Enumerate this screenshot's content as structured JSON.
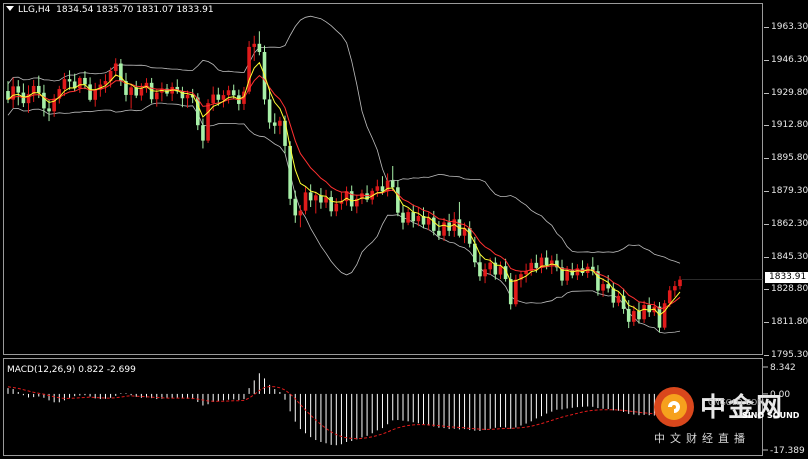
{
  "header": {
    "symbol_tf": "LLG,H4",
    "ohlc": "1834.54 1835.70 1831.07 1833.91"
  },
  "macd": {
    "label": "MACD(12,26,9) 0.822 -2.699",
    "axis_labels": [
      "8.342",
      "0.00",
      "-17.389"
    ]
  },
  "price_axis": [
    "1963.30",
    "1946.30",
    "1929.80",
    "1912.80",
    "1895.80",
    "1879.30",
    "1862.30",
    "1845.30",
    "1828.80",
    "1811.80",
    "1795.30"
  ],
  "current_price": "1833.91",
  "colors": {
    "bull": "#e01b1b",
    "bear": "#a8f0a8",
    "ma": "#ffff33",
    "ma_red": "#ff3030",
    "band": "#bdbdbd",
    "macd_hist": "#ffffff",
    "macd_signal": "#e01b1b"
  },
  "watermark": {
    "brand": "中金网",
    "url": "CNGOLD.COM",
    "sub": "中文财经直播",
    "sound": "SINO SOUND"
  },
  "chart_data": {
    "type": "candlestick",
    "ylim": [
      1795.3,
      1963.3
    ],
    "candles": [
      [
        1930.5,
        1935.6,
        1924.3,
        1926.1
      ],
      [
        1926.1,
        1937.4,
        1921.8,
        1932.9
      ],
      [
        1932.9,
        1936.1,
        1923.2,
        1929.7
      ],
      [
        1929.7,
        1934.4,
        1922.3,
        1924.3
      ],
      [
        1924.3,
        1933.4,
        1919.3,
        1928.9
      ],
      [
        1928.9,
        1936.2,
        1924.9,
        1933.1
      ],
      [
        1933.1,
        1938.4,
        1926.9,
        1929.6
      ],
      [
        1929.6,
        1933.7,
        1917.5,
        1921.6
      ],
      [
        1921.6,
        1926.0,
        1915.1,
        1920.1
      ],
      [
        1920.1,
        1928.9,
        1917.3,
        1926.6
      ],
      [
        1926.6,
        1933.2,
        1924.1,
        1931.5
      ],
      [
        1931.5,
        1939.8,
        1928.0,
        1936.6
      ],
      [
        1936.6,
        1941.1,
        1931.2,
        1935.4
      ],
      [
        1935.4,
        1939.4,
        1930.3,
        1931.9
      ],
      [
        1931.9,
        1938.1,
        1929.5,
        1937.2
      ],
      [
        1937.2,
        1940.7,
        1931.5,
        1933.9
      ],
      [
        1933.9,
        1937.5,
        1925.1,
        1926.0
      ],
      [
        1926.0,
        1934.7,
        1922.5,
        1931.2
      ],
      [
        1931.2,
        1936.6,
        1927.6,
        1933.8
      ],
      [
        1933.8,
        1939.1,
        1929.6,
        1935.6
      ],
      [
        1935.6,
        1942.5,
        1932.3,
        1940.8
      ],
      [
        1940.8,
        1947.3,
        1937.9,
        1944.6
      ],
      [
        1944.6,
        1946.9,
        1933.1,
        1935.6
      ],
      [
        1935.6,
        1939.8,
        1925.2,
        1928.5
      ],
      [
        1928.5,
        1934.2,
        1921.5,
        1932.4
      ],
      [
        1932.4,
        1935.7,
        1926.9,
        1928.2
      ],
      [
        1928.2,
        1934.5,
        1925.6,
        1931.9
      ],
      [
        1931.9,
        1937.1,
        1929.6,
        1934.7
      ],
      [
        1934.7,
        1937.2,
        1924.2,
        1926.3
      ],
      [
        1926.3,
        1931.4,
        1922.5,
        1929.7
      ],
      [
        1929.7,
        1934.9,
        1925.2,
        1931.7
      ],
      [
        1931.7,
        1934.1,
        1927.8,
        1929.2
      ],
      [
        1929.2,
        1934.9,
        1925.4,
        1932.6
      ],
      [
        1932.6,
        1936.5,
        1929.1,
        1930.3
      ],
      [
        1930.3,
        1932.7,
        1922.2,
        1926.8
      ],
      [
        1926.8,
        1930.8,
        1921.9,
        1928.6
      ],
      [
        1928.6,
        1931.6,
        1924.3,
        1927.2
      ],
      [
        1927.2,
        1929.4,
        1910.5,
        1913.0
      ],
      [
        1913.0,
        1916.4,
        1901.1,
        1905.1
      ],
      [
        1905.1,
        1926.3,
        1903.9,
        1924.3
      ],
      [
        1924.3,
        1932.8,
        1920.3,
        1928.7
      ],
      [
        1928.7,
        1932.2,
        1923.0,
        1926.0
      ],
      [
        1926.0,
        1930.9,
        1922.1,
        1928.4
      ],
      [
        1928.4,
        1933.2,
        1924.1,
        1930.9
      ],
      [
        1930.9,
        1933.8,
        1926.5,
        1928.3
      ],
      [
        1928.3,
        1931.2,
        1920.6,
        1923.9
      ],
      [
        1923.9,
        1932.6,
        1920.8,
        1930.2
      ],
      [
        1930.2,
        1956.1,
        1928.9,
        1953.1
      ],
      [
        1953.1,
        1958.8,
        1945.9,
        1954.7
      ],
      [
        1954.7,
        1961.1,
        1948.8,
        1950.5
      ],
      [
        1950.5,
        1953.8,
        1923.6,
        1926.2
      ],
      [
        1926.2,
        1931.9,
        1911.2,
        1914.4
      ],
      [
        1914.4,
        1919.1,
        1908.6,
        1912.7
      ],
      [
        1912.7,
        1917.3,
        1908.4,
        1915.3
      ],
      [
        1915.3,
        1917.9,
        1898.6,
        1902.4
      ],
      [
        1902.4,
        1904.8,
        1872.1,
        1875.3
      ],
      [
        1875.3,
        1879.5,
        1863.0,
        1866.8
      ],
      [
        1866.8,
        1872.1,
        1860.7,
        1869.2
      ],
      [
        1869.2,
        1881.6,
        1867.3,
        1878.6
      ],
      [
        1878.6,
        1882.7,
        1871.1,
        1874.5
      ],
      [
        1874.5,
        1878.9,
        1867.8,
        1877.1
      ],
      [
        1877.1,
        1880.8,
        1870.2,
        1873.4
      ],
      [
        1873.4,
        1879.9,
        1870.6,
        1876.2
      ],
      [
        1876.2,
        1879.4,
        1866.3,
        1868.9
      ],
      [
        1868.9,
        1875.6,
        1866.4,
        1872.8
      ],
      [
        1872.8,
        1878.5,
        1869.7,
        1874.1
      ],
      [
        1874.1,
        1881.6,
        1871.8,
        1879.2
      ],
      [
        1879.2,
        1882.1,
        1869.1,
        1871.4
      ],
      [
        1871.4,
        1877.4,
        1867.9,
        1875.3
      ],
      [
        1875.3,
        1880.0,
        1872.6,
        1878.1
      ],
      [
        1878.1,
        1882.2,
        1873.6,
        1874.9
      ],
      [
        1874.9,
        1880.7,
        1872.4,
        1879.4
      ],
      [
        1879.4,
        1885.1,
        1876.3,
        1881.7
      ],
      [
        1881.7,
        1886.9,
        1877.4,
        1879.1
      ],
      [
        1879.1,
        1888.3,
        1876.5,
        1884.6
      ],
      [
        1884.6,
        1892.1,
        1879.3,
        1881.2
      ],
      [
        1881.2,
        1884.9,
        1866.4,
        1868.2
      ],
      [
        1868.2,
        1871.9,
        1859.6,
        1863.1
      ],
      [
        1863.1,
        1870.4,
        1861.8,
        1868.5
      ],
      [
        1868.5,
        1872.4,
        1860.6,
        1863.8
      ],
      [
        1863.8,
        1871.1,
        1861.3,
        1866.5
      ],
      [
        1866.5,
        1870.9,
        1860.2,
        1862.1
      ],
      [
        1862.1,
        1868.4,
        1859.2,
        1865.7
      ],
      [
        1865.7,
        1869.1,
        1856.6,
        1858.9
      ],
      [
        1858.9,
        1863.9,
        1854.2,
        1856.4
      ],
      [
        1856.4,
        1865.5,
        1853.7,
        1863.2
      ],
      [
        1863.2,
        1867.6,
        1856.2,
        1858.9
      ],
      [
        1858.9,
        1868.5,
        1855.8,
        1864.8
      ],
      [
        1864.8,
        1873.7,
        1855.5,
        1856.4
      ],
      [
        1856.4,
        1863.1,
        1852.6,
        1860.3
      ],
      [
        1860.3,
        1863.8,
        1850.4,
        1852.3
      ],
      [
        1852.3,
        1855.8,
        1840.3,
        1842.8
      ],
      [
        1842.8,
        1847.4,
        1833.3,
        1835.6
      ],
      [
        1835.6,
        1842.2,
        1832.1,
        1839.2
      ],
      [
        1839.2,
        1845.1,
        1836.4,
        1842.6
      ],
      [
        1842.6,
        1845.3,
        1833.9,
        1836.5
      ],
      [
        1836.5,
        1843.2,
        1834.2,
        1840.8
      ],
      [
        1840.8,
        1844.6,
        1832.9,
        1834.2
      ],
      [
        1834.2,
        1837.3,
        1818.6,
        1821.3
      ],
      [
        1821.3,
        1836.4,
        1820.1,
        1833.9
      ],
      [
        1833.9,
        1838.2,
        1829.9,
        1836.7
      ],
      [
        1836.7,
        1842.1,
        1832.4,
        1838.3
      ],
      [
        1838.3,
        1844.6,
        1835.9,
        1842.5
      ],
      [
        1842.5,
        1846.7,
        1837.5,
        1839.9
      ],
      [
        1839.9,
        1847.3,
        1837.2,
        1845.2
      ],
      [
        1845.2,
        1848.9,
        1839.2,
        1841.4
      ],
      [
        1841.4,
        1846.3,
        1836.8,
        1843.7
      ],
      [
        1843.7,
        1847.1,
        1838.2,
        1840.2
      ],
      [
        1840.2,
        1844.1,
        1830.8,
        1833.4
      ],
      [
        1833.4,
        1840.9,
        1831.2,
        1838.6
      ],
      [
        1838.6,
        1842.5,
        1834.6,
        1836.1
      ],
      [
        1836.1,
        1841.8,
        1833.7,
        1839.7
      ],
      [
        1839.7,
        1843.8,
        1835.9,
        1837.3
      ],
      [
        1837.3,
        1842.2,
        1834.8,
        1840.5
      ],
      [
        1840.5,
        1845.4,
        1836.1,
        1838.2
      ],
      [
        1838.2,
        1841.3,
        1825.7,
        1828.3
      ],
      [
        1828.3,
        1834.6,
        1825.1,
        1831.6
      ],
      [
        1831.6,
        1836.2,
        1827.3,
        1829.4
      ],
      [
        1829.4,
        1832.5,
        1819.6,
        1822.1
      ],
      [
        1822.1,
        1827.8,
        1820.3,
        1825.6
      ],
      [
        1825.6,
        1829.3,
        1816.4,
        1818.9
      ],
      [
        1818.9,
        1823.4,
        1809.1,
        1812.3
      ],
      [
        1812.3,
        1820.6,
        1810.2,
        1817.8
      ],
      [
        1817.8,
        1822.3,
        1811.4,
        1813.6
      ],
      [
        1813.6,
        1823.1,
        1811.7,
        1820.9
      ],
      [
        1820.9,
        1824.8,
        1814.8,
        1817.2
      ],
      [
        1817.2,
        1822.7,
        1815.3,
        1820.1
      ],
      [
        1820.1,
        1822.4,
        1806.8,
        1809.3
      ],
      [
        1809.3,
        1823.4,
        1808.2,
        1821.8
      ],
      [
        1821.8,
        1830.6,
        1819.9,
        1828.4
      ],
      [
        1828.4,
        1833.2,
        1825.1,
        1830.6
      ],
      [
        1830.6,
        1835.7,
        1828.9,
        1833.91
      ]
    ],
    "macd_hist": [
      1.8,
      1.5,
      0.6,
      -0.4,
      -1.1,
      -1.0,
      -0.8,
      -1.2,
      -2.0,
      -2.6,
      -2.6,
      -2.0,
      -1.2,
      -0.7,
      -0.5,
      -0.4,
      -0.8,
      -1.4,
      -1.6,
      -1.5,
      -1.2,
      -0.6,
      0.2,
      0.2,
      -0.4,
      -0.9,
      -1.2,
      -1.1,
      -1.3,
      -1.6,
      -1.5,
      -1.4,
      -1.3,
      -1.2,
      -1.4,
      -1.5,
      -1.6,
      -2.5,
      -3.6,
      -3.2,
      -2.5,
      -2.2,
      -2.0,
      -1.8,
      -1.7,
      -1.9,
      -1.6,
      1.8,
      4.2,
      6.4,
      4.8,
      2.8,
      1.5,
      0.6,
      -1.8,
      -5.4,
      -8.6,
      -10.9,
      -12.2,
      -13.4,
      -14.3,
      -14.9,
      -15.3,
      -15.8,
      -15.9,
      -15.6,
      -14.9,
      -14.6,
      -14.1,
      -13.5,
      -13.0,
      -12.2,
      -11.3,
      -10.6,
      -9.4,
      -8.2,
      -8.1,
      -8.3,
      -8.5,
      -8.8,
      -9.1,
      -9.4,
      -9.8,
      -10.1,
      -10.5,
      -10.6,
      -10.9,
      -10.8,
      -11.0,
      -10.9,
      -11.2,
      -11.4,
      -11.5,
      -11.2,
      -10.8,
      -10.5,
      -10.3,
      -10.4,
      -10.8,
      -10.4,
      -9.8,
      -9.2,
      -8.5,
      -7.6,
      -6.9,
      -6.1,
      -5.5,
      -4.9,
      -4.8,
      -4.5,
      -4.3,
      -4.1,
      -4.0,
      -3.9,
      -4.0,
      -4.4,
      -4.6,
      -4.7,
      -5.1,
      -5.2,
      -5.6,
      -6.2,
      -6.4,
      -6.6,
      -6.5,
      -6.6,
      -6.7,
      -7.3,
      -6.4,
      -5.0,
      -3.6,
      -1.8
    ],
    "macd_signal": [
      2.2,
      2.0,
      1.7,
      1.3,
      0.9,
      0.5,
      0.2,
      -0.1,
      -0.5,
      -0.9,
      -1.2,
      -1.4,
      -1.4,
      -1.3,
      -1.2,
      -1.1,
      -1.0,
      -1.1,
      -1.2,
      -1.3,
      -1.3,
      -1.2,
      -1.0,
      -0.7,
      -0.6,
      -0.7,
      -0.8,
      -0.9,
      -1.0,
      -1.1,
      -1.2,
      -1.3,
      -1.3,
      -1.3,
      -1.3,
      -1.3,
      -1.4,
      -1.6,
      -1.9,
      -2.2,
      -2.3,
      -2.3,
      -2.3,
      -2.2,
      -2.1,
      -2.1,
      -2.0,
      -1.3,
      -0.2,
      1.1,
      2.0,
      2.3,
      2.2,
      1.9,
      1.2,
      0.0,
      -1.5,
      -3.3,
      -5.0,
      -6.6,
      -8.1,
      -9.5,
      -10.7,
      -11.8,
      -12.6,
      -13.2,
      -13.6,
      -13.8,
      -13.9,
      -13.8,
      -13.6,
      -13.3,
      -12.9,
      -12.4,
      -11.8,
      -11.1,
      -10.5,
      -10.1,
      -9.8,
      -9.6,
      -9.5,
      -9.5,
      -9.6,
      -9.7,
      -9.8,
      -10.0,
      -10.2,
      -10.3,
      -10.4,
      -10.5,
      -10.7,
      -10.8,
      -10.9,
      -11.0,
      -11.0,
      -10.9,
      -10.8,
      -10.7,
      -10.7,
      -10.6,
      -10.5,
      -10.3,
      -10.0,
      -9.6,
      -9.2,
      -8.7,
      -8.2,
      -7.7,
      -7.2,
      -6.8,
      -6.4,
      -6.0,
      -5.6,
      -5.3,
      -5.1,
      -5.0,
      -4.9,
      -4.9,
      -4.9,
      -5.0,
      -5.1,
      -5.3,
      -5.5,
      -5.7,
      -5.9,
      -6.0,
      -6.2,
      -6.4,
      -6.4,
      -6.1,
      -5.6,
      -4.9
    ],
    "macd_ylim": [
      -17.389,
      8.342
    ]
  }
}
